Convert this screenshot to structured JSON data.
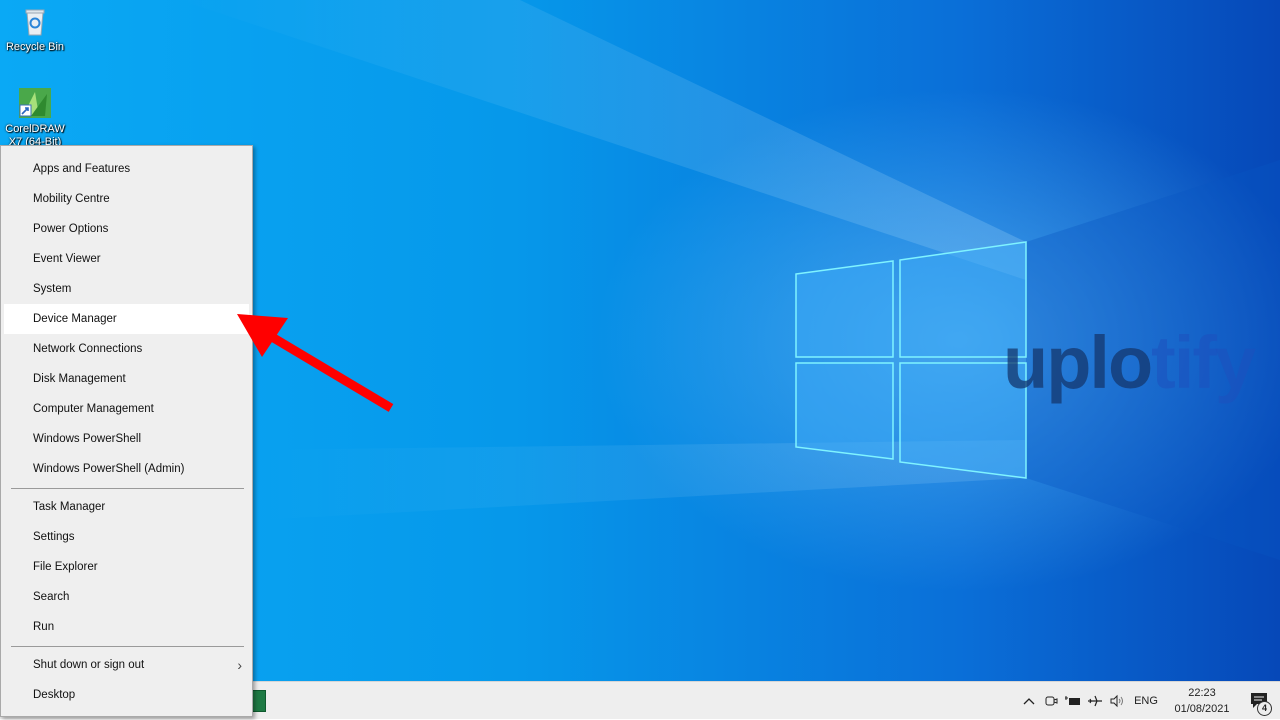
{
  "desktop": {
    "icons": [
      {
        "label_line1": "Recycle Bin",
        "label_line2": "",
        "icon": "recycle-bin-icon"
      },
      {
        "label_line1": "CorelDRAW",
        "label_line2": "X7 (64-Bit)",
        "icon": "coreldraw-icon"
      }
    ],
    "watermark": {
      "part1": "uplo",
      "part2": "tify"
    }
  },
  "context_menu": {
    "items": [
      {
        "label": "Apps and Features"
      },
      {
        "label": "Mobility Centre"
      },
      {
        "label": "Power Options"
      },
      {
        "label": "Event Viewer"
      },
      {
        "label": "System"
      },
      {
        "label": "Device Manager",
        "highlighted": true
      },
      {
        "label": "Network Connections"
      },
      {
        "label": "Disk Management"
      },
      {
        "label": "Computer Management"
      },
      {
        "label": "Windows PowerShell"
      },
      {
        "label": "Windows PowerShell (Admin)"
      },
      {
        "label": "Task Manager"
      },
      {
        "label": "Settings"
      },
      {
        "label": "File Explorer"
      },
      {
        "label": "Search"
      },
      {
        "label": "Run"
      },
      {
        "label": "Shut down or sign out",
        "submenu": true
      },
      {
        "label": "Desktop"
      }
    ]
  },
  "annotation": {
    "arrow_color": "#ff0000",
    "points_to": "Device Manager"
  },
  "taskbar": {
    "tray": {
      "chevron": "show-hidden-icons",
      "language": "ENG",
      "time": "22:23",
      "date": "01/08/2021",
      "notifications_count": "4"
    }
  }
}
